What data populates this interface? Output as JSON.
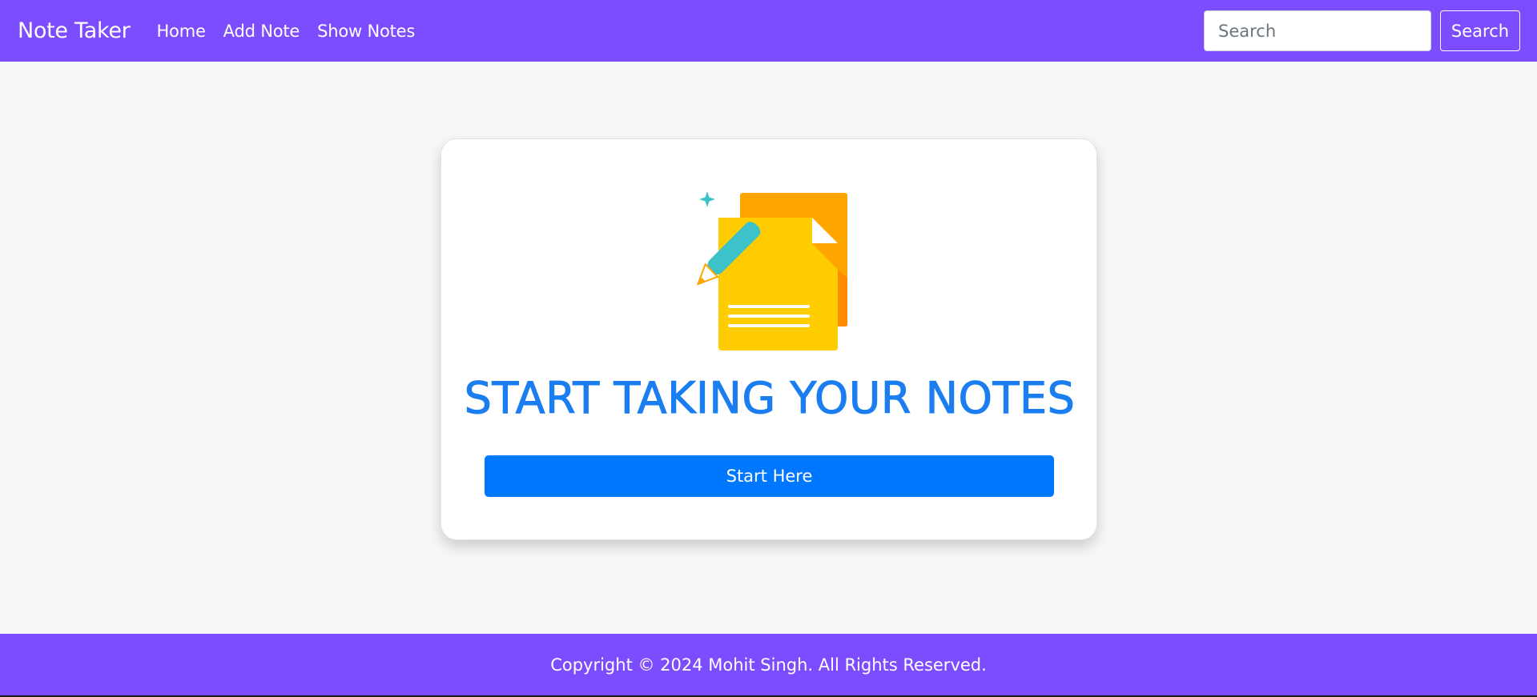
{
  "navbar": {
    "brand": "Note Taker",
    "links": [
      "Home",
      "Add Note",
      "Show Notes"
    ],
    "search_placeholder": "Search",
    "search_button": "Search"
  },
  "hero": {
    "illustration": "notes-icon",
    "headline": "START TAKING YOUR NOTES",
    "button": "Start Here"
  },
  "footer": {
    "copyright": "Copyright © 2024 Mohit Singh. All Rights Reserved."
  },
  "colors": {
    "navbar_bg": "#7c4dff",
    "page_bg": "#f7f8fa",
    "headline": "#1a7ef0",
    "primary_button": "#0077ff"
  }
}
